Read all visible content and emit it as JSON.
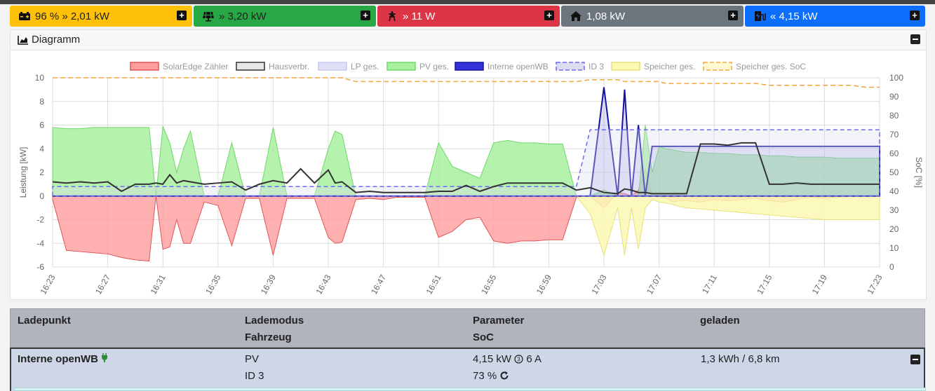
{
  "tiles": [
    {
      "id": "battery",
      "text": "96 % » 2,01 kW",
      "color": "#ffc107",
      "icon": "battery-icon",
      "theme": "light"
    },
    {
      "id": "pv",
      "text": "» 3,20 kW",
      "color": "#28a745",
      "icon": "solar-panel-icon",
      "theme": "light"
    },
    {
      "id": "grid",
      "text": "» 11 W",
      "color": "#dc3545",
      "icon": "power-tower-icon",
      "theme": "light"
    },
    {
      "id": "house",
      "text": "1,08 kW",
      "color": "#6c757d",
      "icon": "home-icon",
      "theme": "light"
    },
    {
      "id": "charge",
      "text": "« 4,15 kW",
      "color": "#0d6efd",
      "icon": "charging-station-icon",
      "theme": "light"
    }
  ],
  "diagram": {
    "title": "Diagramm"
  },
  "chart_data": {
    "type": "area",
    "legend": [
      {
        "label": "SolarEdge Zähler",
        "fill": "#ff9e9e",
        "stroke": "#e05555",
        "dash": false
      },
      {
        "label": "Hausverbr.",
        "fill": "#e8e8e8",
        "stroke": "#333333",
        "dash": false
      },
      {
        "label": "LP ges.",
        "fill": "#e0e0f8",
        "stroke": "#c8c8f0",
        "dash": false
      },
      {
        "label": "PV ges.",
        "fill": "#a8f0a0",
        "stroke": "#6ed86a",
        "dash": false
      },
      {
        "label": "Interne openWB",
        "fill": "#3232d8",
        "stroke": "#1414a0",
        "dash": false
      },
      {
        "label": "ID 3",
        "fill": "#dcdcf0",
        "stroke": "#6c6cf0",
        "dash": true
      },
      {
        "label": "Speicher ges.",
        "fill": "#fbf8b4",
        "stroke": "#e8e078",
        "dash": false
      },
      {
        "label": "Speicher ges. SoC",
        "fill": "#fff8d0",
        "stroke": "#f2a640",
        "dash": true
      }
    ],
    "ylabel": "Leistung [kW]",
    "y2label": "SoC [%]",
    "ylim": [
      -6,
      10
    ],
    "y2lim": [
      0,
      100
    ],
    "yticks": [
      "10",
      "8",
      "6",
      "4",
      "2",
      "0",
      "-2",
      "-4",
      "-6"
    ],
    "y2ticks": [
      "100",
      "90",
      "80",
      "70",
      "60",
      "50",
      "40",
      "30",
      "20",
      "10",
      "0"
    ],
    "xticks": [
      "16:23",
      "16:27",
      "16:31",
      "16:35",
      "16:39",
      "16:43",
      "16:47",
      "16:51",
      "16:55",
      "16:59",
      "17:03",
      "17:07",
      "17:11",
      "17:15",
      "17:19",
      "17:23"
    ],
    "x_minutes": [
      0,
      1,
      2,
      3,
      4,
      5,
      6,
      7,
      7.5,
      8,
      8.5,
      9,
      9.5,
      10,
      11,
      12,
      13,
      14,
      15,
      16,
      17,
      18,
      19,
      20,
      20.5,
      21,
      22,
      23,
      24,
      25,
      26,
      27,
      28,
      29,
      30,
      31,
      32,
      33,
      34,
      35,
      36,
      37,
      38,
      39,
      40,
      41,
      41.5,
      42,
      42.5,
      43,
      43.5,
      44,
      44.5,
      45,
      45.5,
      46,
      47,
      48,
      49,
      50,
      51,
      52,
      53,
      54,
      55,
      56,
      57,
      58,
      59,
      60
    ],
    "pv": [
      5.8,
      5.7,
      5.7,
      5.8,
      5.8,
      5.8,
      5.8,
      5.8,
      0,
      5.9,
      4.5,
      2,
      4,
      5.5,
      0,
      0,
      4.5,
      0,
      0,
      5.8,
      0,
      0,
      0,
      4,
      5.5,
      5.2,
      0,
      0,
      0,
      0,
      0,
      0,
      4.5,
      2.5,
      2,
      1.5,
      4.5,
      4.7,
      4.5,
      4.5,
      4.4,
      4.4,
      0,
      0,
      0.5,
      0,
      0,
      0,
      0,
      6,
      2,
      4.2,
      4,
      3.9,
      3.8,
      3.7,
      3.7,
      3.6,
      3.6,
      3.5,
      3.5,
      3.4,
      3.4,
      3.3,
      3.3,
      3.3,
      3.2,
      3.2,
      3.2,
      3.2
    ],
    "solaredge": [
      -0.3,
      -4.6,
      -4.7,
      -4.8,
      -4.9,
      -5.2,
      -5.4,
      -5.5,
      0,
      -4.5,
      -4.3,
      -2,
      -4,
      -4,
      -0.5,
      -0.8,
      -4.2,
      -0.2,
      -0.2,
      -5,
      -0.2,
      -0.2,
      -0.2,
      -3.5,
      -4,
      -3.9,
      -0.3,
      -0.2,
      -0.3,
      -0.1,
      -0.1,
      -0.1,
      -3.5,
      -3,
      -2,
      -1.8,
      -3.8,
      -4,
      -3.8,
      -3.8,
      -3.7,
      -3.7,
      -0.1,
      0,
      -1,
      0.3,
      0.2,
      0,
      0.5,
      2.3,
      0,
      -0.1,
      -0.2,
      -0.5,
      -0.4,
      -0.4,
      -0.5,
      -0.3,
      -0.4,
      -0.3,
      -0.2,
      -0.4,
      -0.5,
      -0.3,
      -0.1,
      -0.2,
      -0.1,
      0,
      0,
      0
    ],
    "hausverbr": [
      1.2,
      1.1,
      1.2,
      1.1,
      1.2,
      0.4,
      1,
      1,
      1.1,
      1,
      1.8,
      1.1,
      1.3,
      1.2,
      1,
      1.1,
      1.2,
      0.5,
      1,
      1.3,
      1.1,
      2.3,
      1.1,
      2.2,
      1.1,
      1.2,
      0.3,
      0.4,
      0.3,
      0.3,
      0.3,
      0.3,
      0.4,
      0.4,
      0.9,
      0.4,
      0.8,
      1.1,
      1.1,
      1.1,
      1.1,
      1.1,
      0.5,
      0.7,
      0.3,
      0.2,
      0.6,
      0.5,
      0.3,
      0.3,
      0.2,
      0.2,
      0.2,
      0.2,
      0.2,
      0.2,
      4.4,
      4.4,
      4.3,
      4.5,
      4.5,
      1,
      1,
      1.1,
      1,
      1,
      1,
      1,
      1,
      1
    ],
    "openwb": [
      0,
      0,
      0,
      0,
      0,
      0,
      0,
      0,
      0,
      0,
      0,
      0,
      0,
      0,
      0,
      0,
      0,
      0,
      0,
      0,
      0,
      0,
      0,
      0,
      0,
      0,
      0,
      0,
      0,
      0,
      0,
      0,
      0,
      0,
      0,
      0,
      0,
      0,
      0,
      0,
      0,
      0,
      0,
      0,
      9.2,
      0,
      9,
      0,
      6,
      0,
      4.2,
      4.2,
      4.2,
      4.2,
      4.2,
      4.2,
      4.2,
      4.2,
      4.2,
      4.2,
      4.2,
      4.2,
      4.2,
      4.2,
      4.2,
      4.2,
      4.2,
      4.2,
      4.2,
      4.2
    ],
    "speicher": [
      0,
      0,
      0,
      0,
      0,
      0,
      0,
      0,
      0,
      0,
      0,
      0,
      0,
      0,
      0,
      0,
      0,
      0,
      0,
      0,
      0,
      0,
      0,
      0,
      0,
      0,
      0,
      0,
      0,
      0,
      0,
      0,
      0,
      0,
      0,
      0,
      0,
      0,
      0,
      0,
      0,
      0,
      0,
      -1.5,
      -5,
      -1,
      -5,
      -1,
      -4.5,
      -1,
      -0.3,
      -0.5,
      -0.6,
      -0.7,
      -0.9,
      -1,
      -1.1,
      -1.2,
      -1.3,
      -1.4,
      -1.5,
      -1.6,
      -1.7,
      -1.8,
      -1.9,
      -2,
      -2,
      -2,
      -2,
      -2
    ],
    "id3": [
      0.8,
      0.8,
      0.8,
      0.8,
      0.8,
      0.8,
      0.8,
      0.8,
      0.8,
      0.8,
      0.8,
      0.8,
      0.8,
      0.8,
      0.8,
      0.8,
      0.8,
      0.8,
      0.8,
      0.8,
      0.8,
      0.8,
      0.8,
      0.8,
      0.8,
      0.8,
      0.8,
      0.8,
      0.8,
      0.8,
      0.8,
      0.8,
      0.8,
      0.8,
      0.8,
      0.8,
      0.8,
      0.8,
      0.8,
      0.8,
      0.8,
      0.8,
      0.8,
      5.6,
      5.6,
      5.6,
      5.6,
      5.6,
      5.6,
      5.6,
      5.6,
      5.6,
      5.6,
      5.6,
      5.6,
      5.6,
      5.6,
      5.6,
      5.6,
      5.6,
      5.6,
      5.6,
      5.6,
      5.6,
      5.6,
      5.6,
      5.6,
      5.6,
      5.6,
      5.6
    ],
    "soc": [
      100,
      100,
      100,
      100,
      100,
      100,
      100,
      100,
      100,
      100,
      100,
      100,
      100,
      100,
      100,
      100,
      100,
      100,
      100,
      100,
      100,
      100,
      100,
      100,
      100,
      100,
      98,
      98,
      98,
      98,
      98,
      98,
      98,
      98,
      98,
      98,
      98,
      98,
      98,
      98,
      98,
      98,
      98,
      99,
      99,
      99,
      98,
      98,
      98,
      98,
      98,
      98,
      97,
      97,
      97,
      97,
      97,
      97,
      97,
      97,
      97,
      96,
      96,
      96,
      96,
      96,
      96,
      96,
      95,
      95
    ]
  },
  "table": {
    "headers": {
      "col1": "Ladepunkt",
      "col2a": "Lademodus",
      "col2b": "Fahrzeug",
      "col3a": "Parameter",
      "col3b": "SoC",
      "col4": "geladen"
    },
    "row": {
      "name": "Interne openWB",
      "mode": "PV",
      "vehicle": "ID 3",
      "power": "4,15 kW",
      "phases": "6 A",
      "soc": "73 %",
      "charged": "1,3 kWh / 6,8 km"
    }
  }
}
